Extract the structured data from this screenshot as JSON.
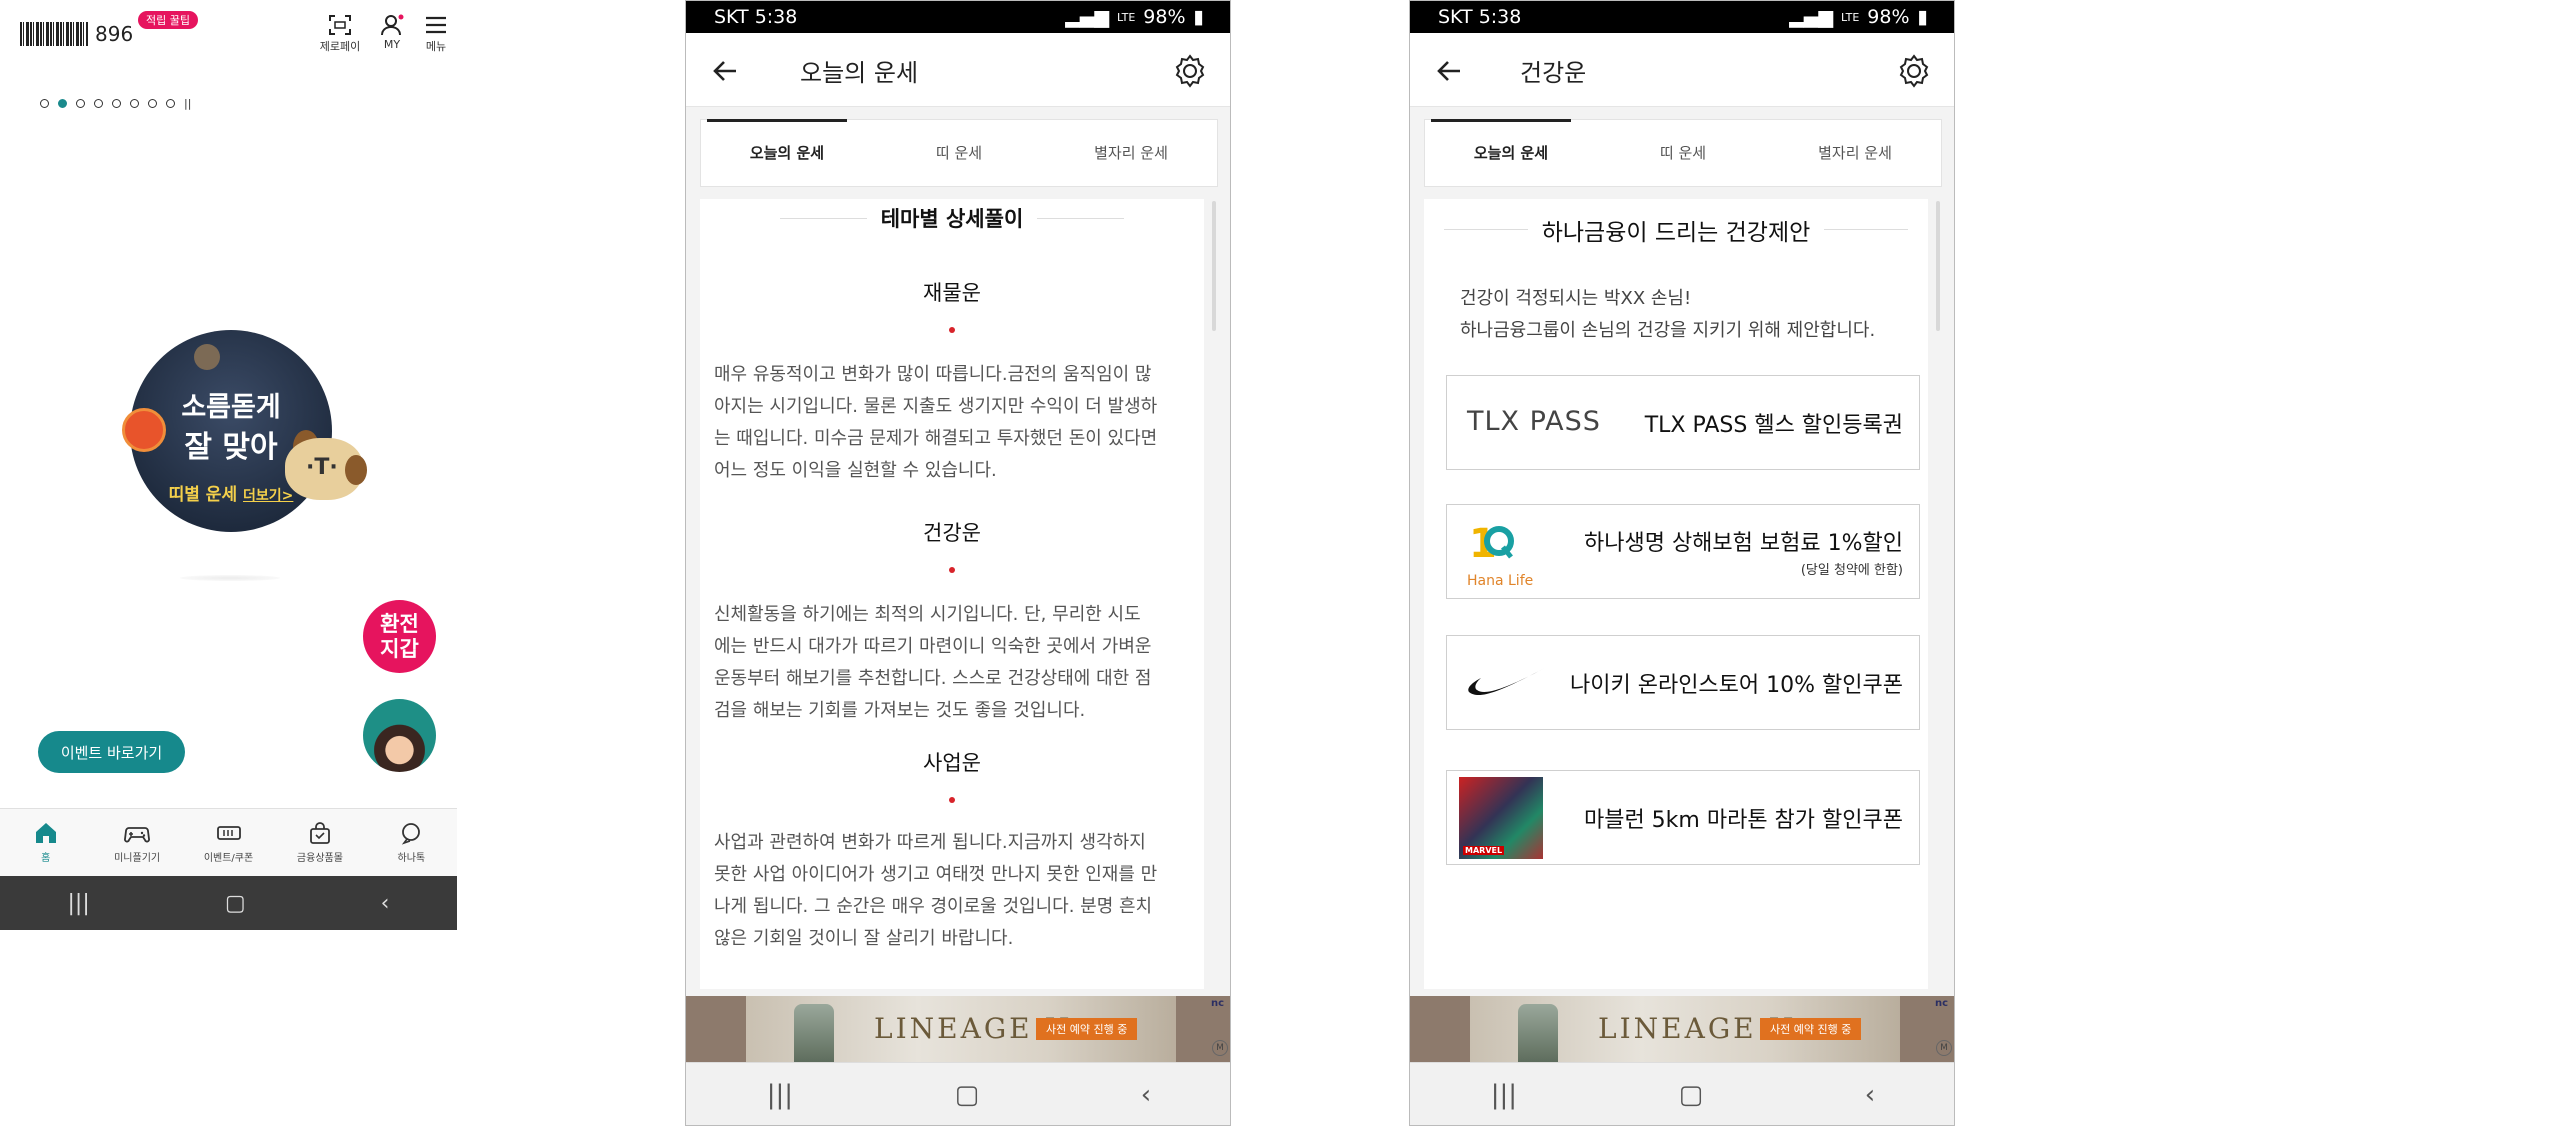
{
  "panel1": {
    "points": "896",
    "points_badge": "적립 꿀팁",
    "top_icons": [
      {
        "label": "제로페이",
        "icon": "scan-icon"
      },
      {
        "label": "MY",
        "icon": "person-icon"
      },
      {
        "label": "메뉴",
        "icon": "menu-icon"
      }
    ],
    "carousel_dot_count": 8,
    "carousel_active_index": 1,
    "carousel_pause": "||",
    "promo": {
      "line1": "소름돋게",
      "line2": "잘 맞아",
      "link": "띠별 운세",
      "link_more": "더보기>"
    },
    "fab_label": "환전\n지갑",
    "event_button": "이벤트 바로가기",
    "tabs": [
      {
        "label": "홈",
        "icon": "home-icon",
        "active": true
      },
      {
        "label": "미니플기기",
        "icon": "gamepad-icon",
        "active": false
      },
      {
        "label": "이벤트/쿠폰",
        "icon": "ticket-icon",
        "active": false
      },
      {
        "label": "금융상품몰",
        "icon": "shopping-bag-icon",
        "active": false
      },
      {
        "label": "하나톡",
        "icon": "chat-icon",
        "active": false
      }
    ],
    "nav": {
      "recent": "|||",
      "home": "▢",
      "back": "‹"
    }
  },
  "status": {
    "time": "SKT 5:38",
    "battery": "98%",
    "net": "LTE"
  },
  "panel2": {
    "title": "오늘의 운세",
    "tabs": [
      "오늘의 운세",
      "띠 운세",
      "별자리 운세"
    ],
    "section_title": "테마별 상세풀이",
    "sections": [
      {
        "heading": "재물운",
        "lines": [
          "매우 유동적이고 변화가 많이 따릅니다.금전의 움직임이 많",
          "아지는 시기입니다. 물론 지출도 생기지만 수익이 더 발생하",
          "는 때입니다. 미수금 문제가 해결되고 투자했던 돈이 있다면",
          " 어느 정도 이익을 실현할 수 있습니다."
        ]
      },
      {
        "heading": "건강운",
        "lines": [
          "신체활동을 하기에는 최적의 시기입니다. 단, 무리한 시도",
          "에는 반드시 대가가 따르기 마련이니 익숙한 곳에서 가벼운",
          "운동부터 해보기를 추천합니다. 스스로 건강상태에 대한 점",
          "검을 해보는 기회를 가져보는 것도 좋을 것입니다."
        ]
      },
      {
        "heading": "사업운",
        "lines": [
          "사업과 관련하여 변화가 따르게 됩니다.지금까지 생각하지",
          "못한 사업 아이디어가 생기고 여태껏 만나지 못한 인재를 만",
          "나게 됩니다. 그 순간은 매우 경이로울 것입니다. 분명 흔치",
          " 않은 기회일 것이니 잘 살리기 바랍니다."
        ]
      }
    ]
  },
  "panel3": {
    "title": "건강운",
    "tabs": [
      "오늘의 운세",
      "띠 운세",
      "별자리 운세"
    ],
    "section_title": "하나금융이 드리는 건강제안",
    "greeting_line1": "건강이 걱정되시는 박XX 손님!",
    "greeting_line2": "하나금융그룹이 손님의 건강을 지키기 위해 제안합니다.",
    "coupons": [
      {
        "logo": "TLX PASS",
        "text": "TLX PASS 헬스 할인등록권",
        "note": ""
      },
      {
        "logo": "Hana Life",
        "text": "하나생명 상해보험 보험료 1%할인",
        "note": "(당일 청약에 한함)"
      },
      {
        "logo": "swoosh",
        "text": "나이키 온라인스토어 10% 할인쿠폰",
        "note": ""
      },
      {
        "logo": "MARVEL",
        "text": "마블런 5km 마라톤 참가 할인쿠폰",
        "note": ""
      }
    ]
  },
  "ad": {
    "logo": "LINEAGE II",
    "button": "사전 예약 진행 중",
    "brand": "nc",
    "mark": "M"
  },
  "colors": {
    "teal": "#16898c",
    "pink": "#e6145e",
    "red_dot": "#d8232a"
  }
}
